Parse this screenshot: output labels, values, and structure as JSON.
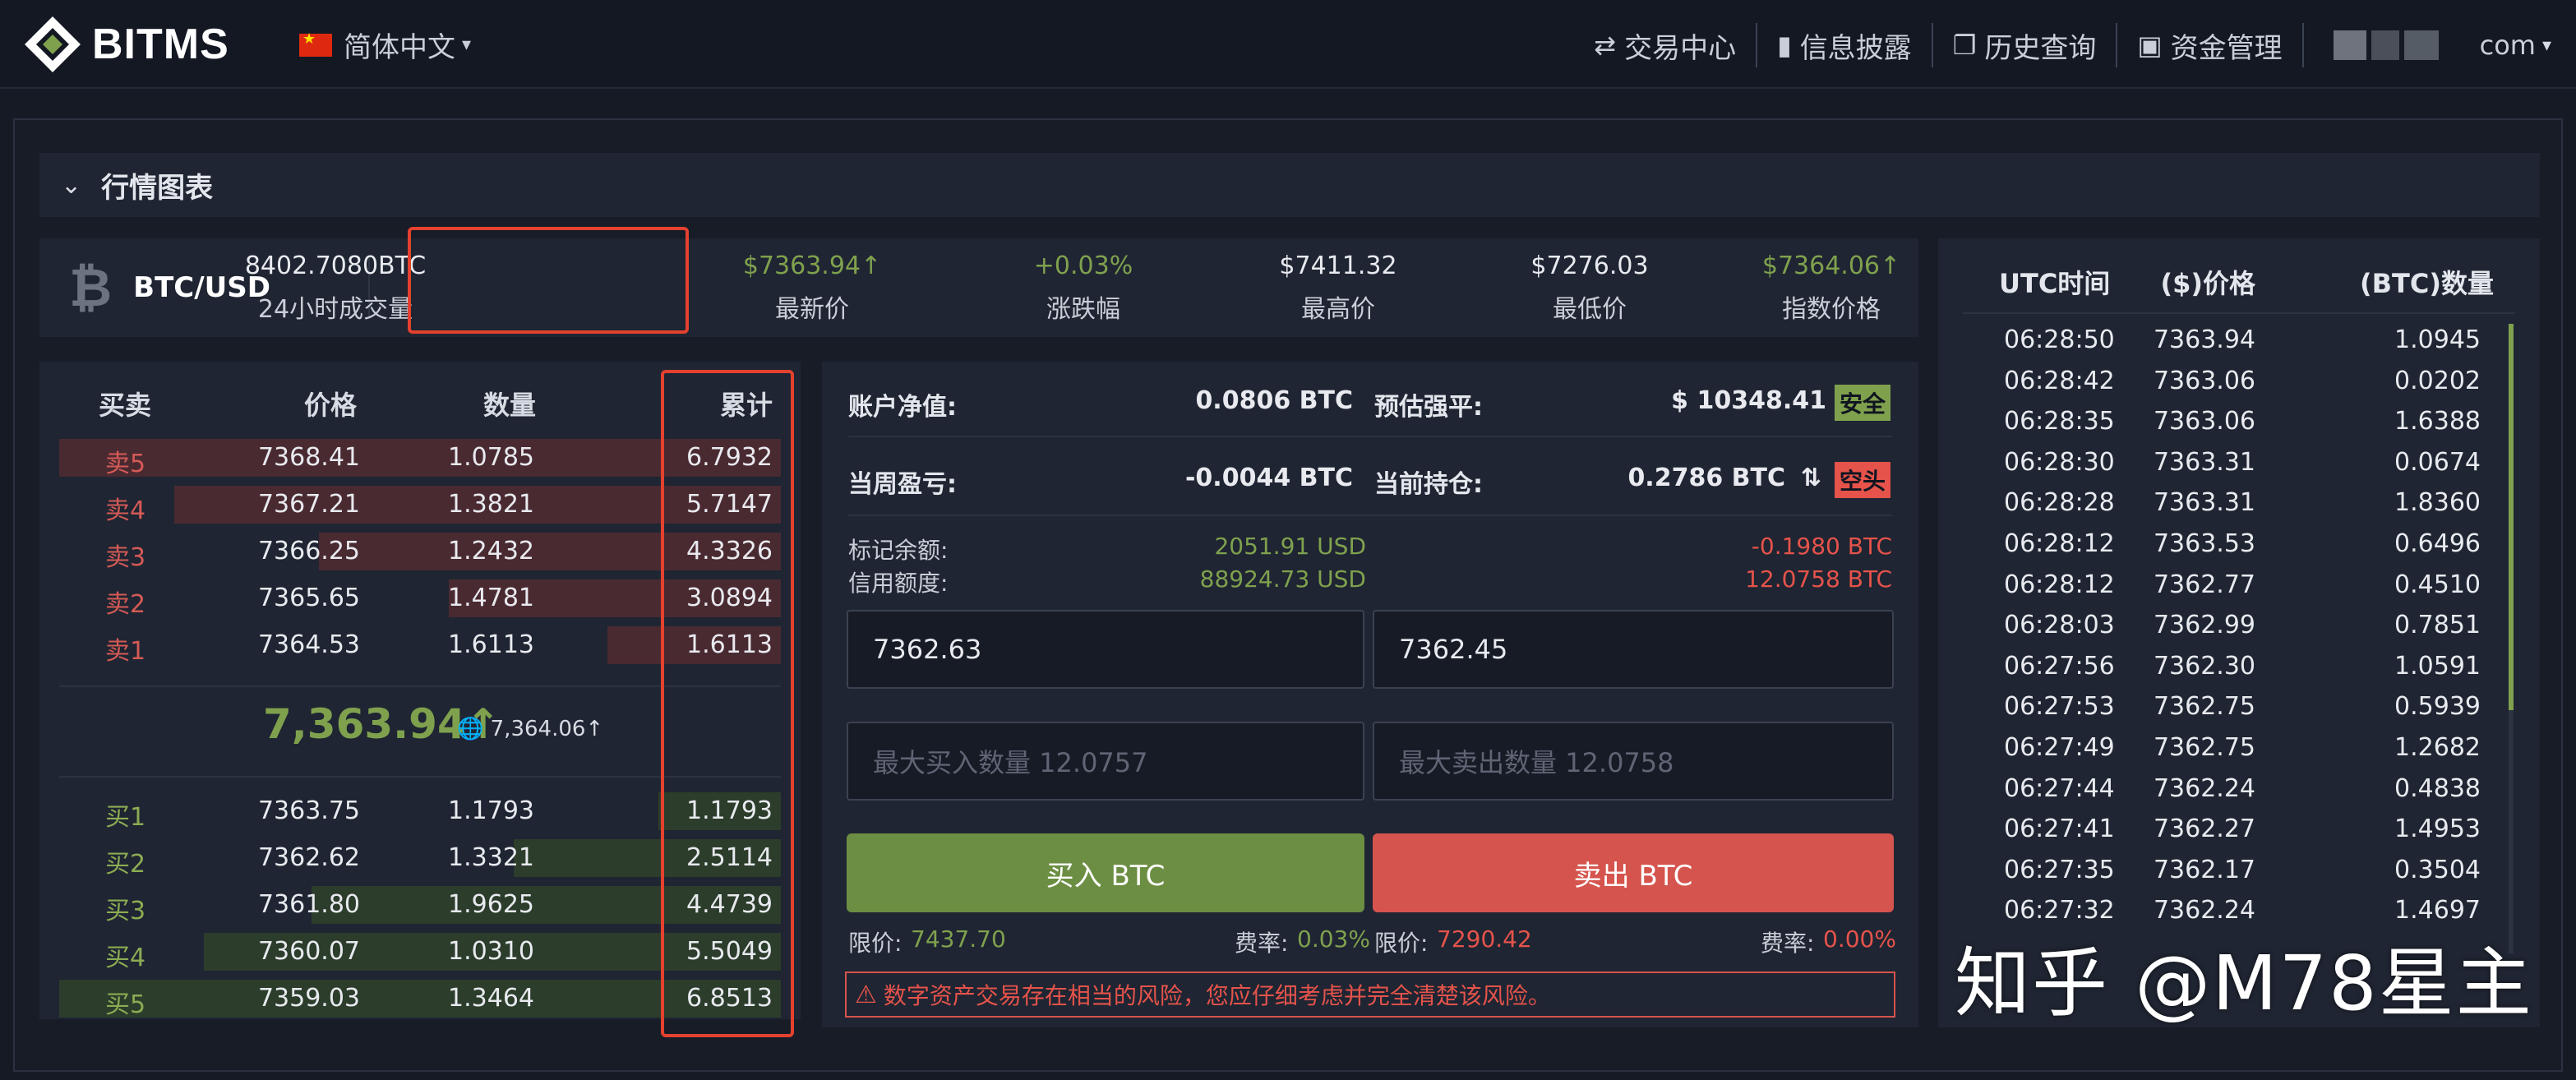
{
  "header": {
    "brand": "BITMS",
    "language": "简体中文",
    "nav": [
      {
        "label": "交易中心",
        "icon": "swap-icon"
      },
      {
        "label": "信息披露",
        "icon": "book-icon"
      },
      {
        "label": "历史查询",
        "icon": "document-icon"
      },
      {
        "label": "资金管理",
        "icon": "briefcase-icon"
      }
    ],
    "account_suffix": "com"
  },
  "section": {
    "title": "行情图表"
  },
  "ticker": {
    "pair": "BTC/USD",
    "volume": {
      "value": "8402.7080BTC",
      "label": "24小时成交量"
    },
    "last": {
      "value": "$7363.94↑",
      "label": "最新价"
    },
    "change": {
      "value": "+0.03%",
      "label": "涨跌幅"
    },
    "high": {
      "value": "$7411.32",
      "label": "最高价"
    },
    "low": {
      "value": "$7276.03",
      "label": "最低价"
    },
    "index": {
      "value": "$7364.06↑",
      "label": "指数价格"
    }
  },
  "orderbook": {
    "headers": {
      "side": "买卖",
      "price": "价格",
      "qty": "数量",
      "total": "累计"
    },
    "asks": [
      {
        "side": "卖5",
        "price": "7368.41",
        "qty": "1.0785",
        "total": "6.7932",
        "depth": 1.0
      },
      {
        "side": "卖4",
        "price": "7367.21",
        "qty": "1.3821",
        "total": "5.7147",
        "depth": 0.84
      },
      {
        "side": "卖3",
        "price": "7366.25",
        "qty": "1.2432",
        "total": "4.3326",
        "depth": 0.64
      },
      {
        "side": "卖2",
        "price": "7365.65",
        "qty": "1.4781",
        "total": "3.0894",
        "depth": 0.46
      },
      {
        "side": "卖1",
        "price": "7364.53",
        "qty": "1.6113",
        "total": "1.6113",
        "depth": 0.24
      }
    ],
    "mid_price": "7,363.94↑",
    "mid_index": "7,364.06↑",
    "bids": [
      {
        "side": "买1",
        "price": "7363.75",
        "qty": "1.1793",
        "total": "1.1793",
        "depth": 0.17
      },
      {
        "side": "买2",
        "price": "7362.62",
        "qty": "1.3321",
        "total": "2.5114",
        "depth": 0.37
      },
      {
        "side": "买3",
        "price": "7361.80",
        "qty": "1.9625",
        "total": "4.4739",
        "depth": 0.65
      },
      {
        "side": "买4",
        "price": "7360.07",
        "qty": "1.0310",
        "total": "5.5049",
        "depth": 0.8
      },
      {
        "side": "买5",
        "price": "7359.03",
        "qty": "1.3464",
        "total": "6.8513",
        "depth": 1.0
      }
    ]
  },
  "trade_panel": {
    "net_value_label": "账户净值:",
    "net_value": "0.0806 BTC",
    "liq_label": "预估强平:",
    "liq_value": "$ 10348.41",
    "liq_status": "安全",
    "weekly_pnl_label": "当周盈亏:",
    "weekly_pnl": "-0.0044 BTC",
    "position_label": "当前持仓:",
    "position_value": "0.2786 BTC",
    "position_side": "空头",
    "mark_balance_label": "标记余额:",
    "mark_balance_usd": "2051.91 USD",
    "mark_balance_btc": "-0.1980 BTC",
    "credit_label": "信用额度:",
    "credit_usd": "88924.73 USD",
    "credit_btc": "12.0758 BTC",
    "buy_price_input": "7362.63",
    "sell_price_input": "7362.45",
    "buy_qty_placeholder": "最大买入数量 12.0757",
    "sell_qty_placeholder": "最大卖出数量 12.0758",
    "buy_button": "买入 BTC",
    "sell_button": "卖出 BTC",
    "limit_label": "限价:",
    "buy_limit": "7437.70",
    "sell_limit": "7290.42",
    "fee_label": "费率:",
    "buy_fee": "0.03%",
    "sell_fee": "0.00%",
    "risk_warning": "数字资产交易存在相当的风险，您应仔细考虑并完全清楚该风险。"
  },
  "trades": {
    "headers": {
      "time": "UTC时间",
      "price": "($)价格",
      "qty": "(BTC)数量"
    },
    "rows": [
      {
        "time": "06:28:50",
        "price": "7363.94",
        "qty": "1.0945"
      },
      {
        "time": "06:28:42",
        "price": "7363.06",
        "qty": "0.0202"
      },
      {
        "time": "06:28:35",
        "price": "7363.06",
        "qty": "1.6388"
      },
      {
        "time": "06:28:30",
        "price": "7363.31",
        "qty": "0.0674"
      },
      {
        "time": "06:28:28",
        "price": "7363.31",
        "qty": "1.8360"
      },
      {
        "time": "06:28:12",
        "price": "7363.53",
        "qty": "0.6496"
      },
      {
        "time": "06:28:12",
        "price": "7362.77",
        "qty": "0.4510"
      },
      {
        "time": "06:28:03",
        "price": "7362.99",
        "qty": "0.7851"
      },
      {
        "time": "06:27:56",
        "price": "7362.30",
        "qty": "1.0591"
      },
      {
        "time": "06:27:53",
        "price": "7362.75",
        "qty": "0.5939"
      },
      {
        "time": "06:27:49",
        "price": "7362.75",
        "qty": "1.2682"
      },
      {
        "time": "06:27:44",
        "price": "7362.24",
        "qty": "0.4838"
      },
      {
        "time": "06:27:41",
        "price": "7362.27",
        "qty": "1.4953"
      },
      {
        "time": "06:27:35",
        "price": "7362.17",
        "qty": "0.3504"
      },
      {
        "time": "06:27:32",
        "price": "7362.24",
        "qty": "1.4697"
      }
    ]
  },
  "watermark": "知乎 @M78星主",
  "colors": {
    "green": "#7fa14e",
    "red": "#e5534b",
    "highlight": "#e4412e"
  }
}
